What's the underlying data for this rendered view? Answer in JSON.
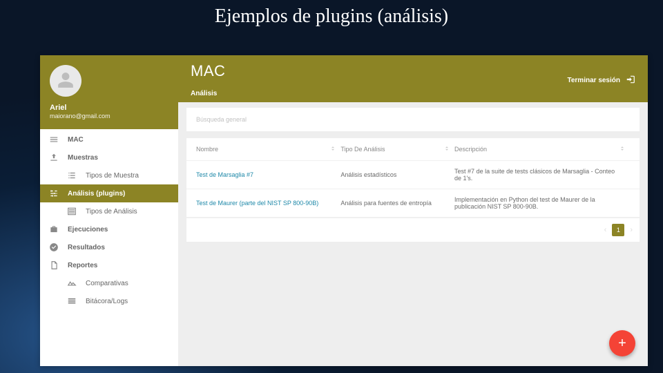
{
  "slide": {
    "title": "Ejemplos de plugins (análisis)"
  },
  "profile": {
    "name": "Ariel",
    "email": "maiorano@gmail.com"
  },
  "header": {
    "title": "MAC",
    "subtitle": "Análisis",
    "logout": "Terminar sesión"
  },
  "search": {
    "placeholder": "Búsqueda general"
  },
  "nav": [
    {
      "label": "MAC",
      "icon": "bars"
    },
    {
      "label": "Muestras",
      "icon": "upload"
    },
    {
      "label": "Tipos de Muestra",
      "icon": "list",
      "child": true
    },
    {
      "label": "Análisis (plugins)",
      "icon": "sliders",
      "active": true
    },
    {
      "label": "Tipos de Análisis",
      "icon": "list-alt",
      "child": true
    },
    {
      "label": "Ejecuciones",
      "icon": "briefcase"
    },
    {
      "label": "Resultados",
      "icon": "check-circle"
    },
    {
      "label": "Reportes",
      "icon": "pages"
    },
    {
      "label": "Comparativas",
      "icon": "compare",
      "child": true
    },
    {
      "label": "Bitácora/Logs",
      "icon": "rows",
      "child": true
    }
  ],
  "table": {
    "columns": {
      "name": "Nombre",
      "type": "Tipo De Análisis",
      "desc": "Descripción"
    },
    "rows": [
      {
        "name": "Test de Marsaglia #7",
        "type": "Análisis estadísticos",
        "desc": "Test #7 de la suite de tests clásicos de Marsaglia - Conteo de 1's."
      },
      {
        "name": "Test de Maurer (parte del NIST SP 800-90B)",
        "type": "Análisis para fuentes de entropía",
        "desc": "Implementación en Python del test de Maurer de la publicación NIST SP 800-90B."
      }
    ]
  },
  "pager": {
    "current": "1"
  },
  "fab": {
    "label": "+"
  }
}
